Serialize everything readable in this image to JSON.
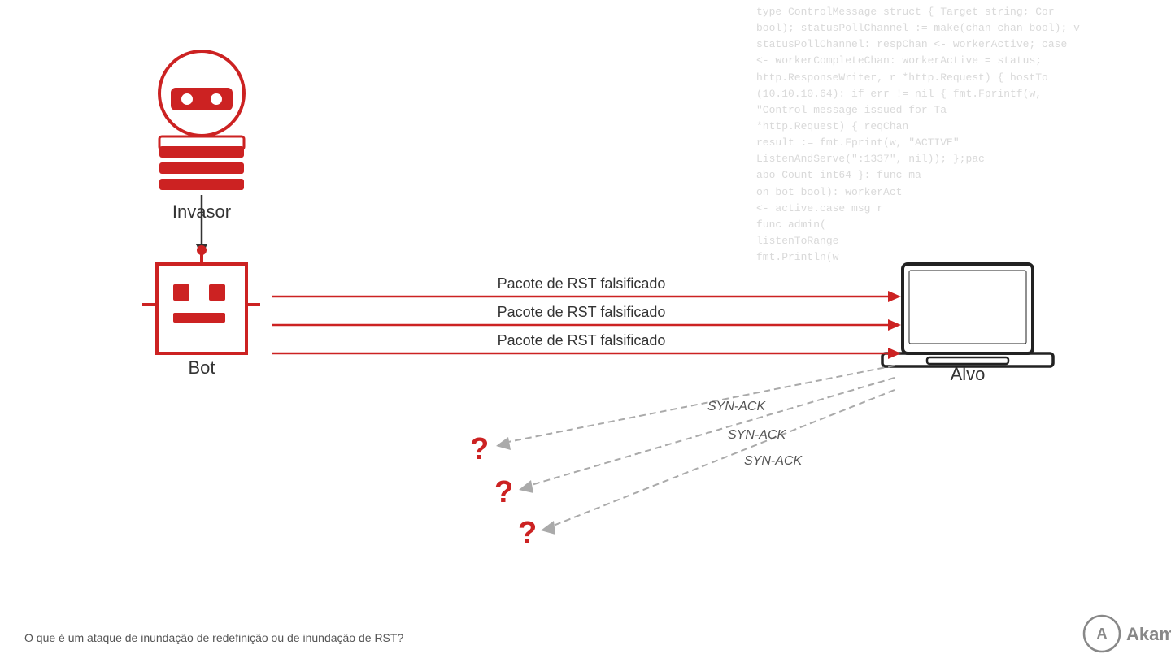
{
  "code_bg": {
    "lines": "type ControlMessage struct { Target string; Cor\nbool); statusPollChannel := make(chan chan bool); v\nstatusPollChannel: respChan <- workerActive; case\n<- workerCompleteChan: workerActive = status;\nhttp.ResponseWriter, r *http.Request) { hostTo\n(10.10.10.64): if err != nil { fmt.Fprintf(w,\n\"Control message issued for Ta\n*http.Request) { reqChan\nresult := fmt.Fprint(w, \"ACTIVE\"\nListenAndServe(\":1337\", nil)); };pac\nabo Count int64 }: func ma\non bot bool): workerAct\n<- active.case msg r\nfunc admin(\nlistenToRange\nfmt.Println(w"
  },
  "invasor": {
    "label": "Invasor"
  },
  "bot": {
    "label": "Bot"
  },
  "alvo": {
    "label": "Alvo"
  },
  "packets": [
    {
      "label": "Pacote de RST falsificado"
    },
    {
      "label": "Pacote de RST falsificado"
    },
    {
      "label": "Pacote de RST falsificado"
    }
  ],
  "synack": {
    "labels": [
      "SYN-ACK",
      "SYN-ACK",
      "SYN-ACK"
    ]
  },
  "bottom_text": "O que é um ataque de inundação de redefinição ou de inundação de RST?",
  "akamai": {
    "label": "Akamai"
  }
}
